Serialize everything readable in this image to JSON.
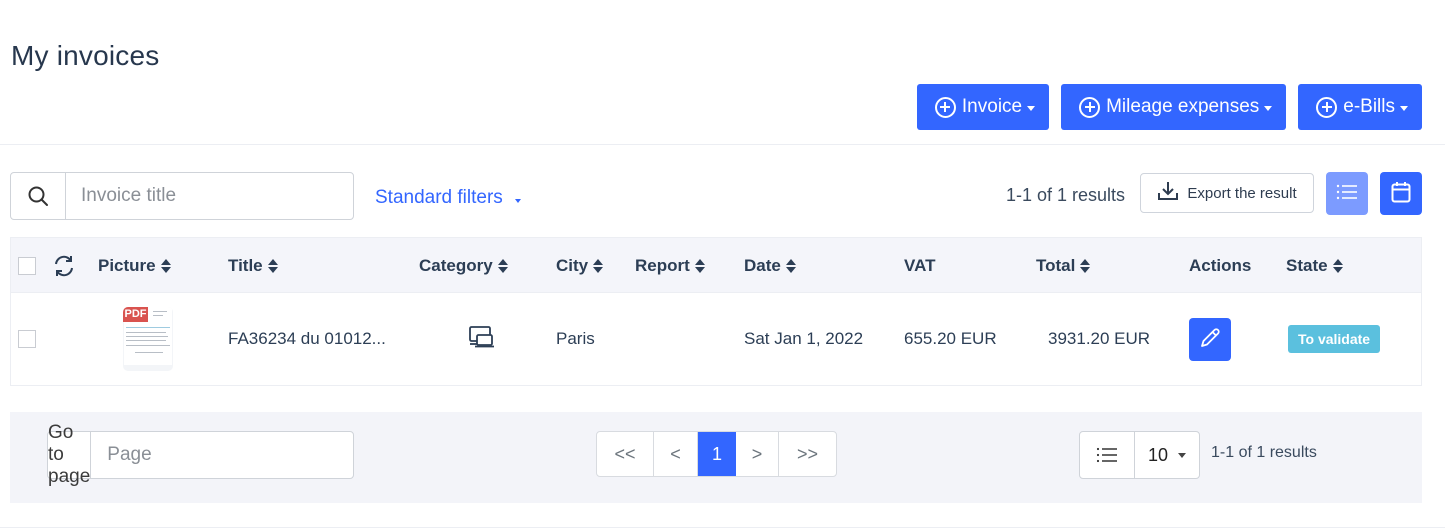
{
  "page": {
    "title": "My invoices"
  },
  "top_actions": [
    {
      "label": "Invoice",
      "icon": "plus-circle-icon"
    },
    {
      "label": "Mileage expenses",
      "icon": "plus-circle-icon"
    },
    {
      "label": "e-Bills",
      "icon": "plus-circle-icon"
    }
  ],
  "toolbar": {
    "search_placeholder": "Invoice title",
    "search_value": "",
    "standard_filters_label": "Standard filters",
    "results_summary": "1-1 of 1 results",
    "export_label": "Export the result",
    "view_list_icon": "list-icon",
    "view_calendar_icon": "calendar-icon"
  },
  "table": {
    "columns": [
      {
        "key": "picture",
        "label": "Picture",
        "sortable": true
      },
      {
        "key": "title",
        "label": "Title",
        "sortable": true
      },
      {
        "key": "category",
        "label": "Category",
        "sortable": true
      },
      {
        "key": "city",
        "label": "City",
        "sortable": true
      },
      {
        "key": "report",
        "label": "Report",
        "sortable": true
      },
      {
        "key": "date",
        "label": "Date",
        "sortable": true
      },
      {
        "key": "vat",
        "label": "VAT",
        "sortable": false
      },
      {
        "key": "total",
        "label": "Total",
        "sortable": true
      },
      {
        "key": "actions",
        "label": "Actions",
        "sortable": false
      },
      {
        "key": "state",
        "label": "State",
        "sortable": true
      }
    ],
    "rows": [
      {
        "picture_tag": "PDF",
        "title": "FA36234 du 01012...",
        "category_icon": "devices-icon",
        "city": "Paris",
        "report": "",
        "date": "Sat Jan 1, 2022",
        "vat": "655.20 EUR",
        "total": "3931.20 EUR",
        "action_icon": "pencil-icon",
        "state": "To validate"
      }
    ]
  },
  "pagination": {
    "goto_label": "Go to page",
    "page_placeholder": "Page",
    "first": "<<",
    "prev": "<",
    "current": "1",
    "next": ">",
    "last": ">>",
    "per_page": "10",
    "results_summary": "1-1 of 1 results"
  },
  "colors": {
    "primary": "#3366ff",
    "primary_light": "#7c9bff",
    "state_to_validate": "#5bc0de",
    "pdf_red": "#d9534f"
  }
}
